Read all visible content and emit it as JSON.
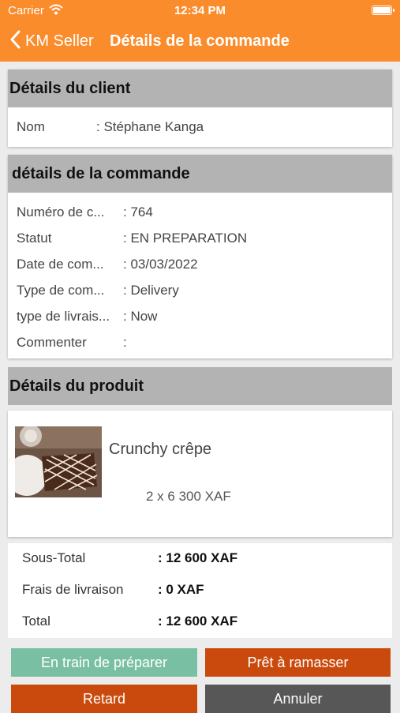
{
  "status_bar": {
    "carrier": "Carrier",
    "time": "12:34 PM"
  },
  "nav": {
    "back_label": "KM Seller",
    "title": "Détails de la commande"
  },
  "client": {
    "header": "Détails du client",
    "name_label": "Nom",
    "name_value": ": Stéphane  Kanga"
  },
  "order": {
    "header": "détails de la commande",
    "rows": [
      {
        "label": "Numéro de c...",
        "value": ": 764"
      },
      {
        "label": "Statut",
        "value": ": EN PREPARATION"
      },
      {
        "label": "Date de com...",
        "value": ": 03/03/2022"
      },
      {
        "label": "Type de com...",
        "value": ": Delivery"
      },
      {
        "label": "type de livrais...",
        "value": ": Now"
      },
      {
        "label": "Commenter",
        "value": ":"
      }
    ]
  },
  "product": {
    "header": "Détails du produit",
    "name": "Crunchy crêpe",
    "price_line": "2 x 6 300 XAF"
  },
  "summary": {
    "subtotal_label": "Sous-Total",
    "subtotal_value": ": 12 600 XAF",
    "delivery_label": "Frais de livraison",
    "delivery_value": ": 0 XAF",
    "total_label": "Total",
    "total_value": ": 12 600 XAF"
  },
  "actions": {
    "preparing": "En train de préparer",
    "ready": "Prêt à ramasser",
    "delay": "Retard",
    "cancel": "Annuler"
  },
  "colors": {
    "brand": "#fb8c2c",
    "preparing": "#79bfa3",
    "ready": "#c94a0c",
    "delay": "#c94a0c",
    "cancel": "#575757"
  }
}
